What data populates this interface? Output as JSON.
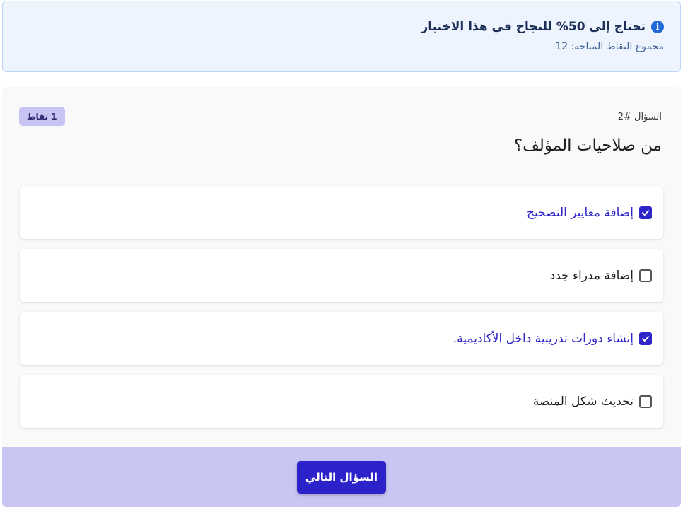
{
  "info": {
    "icon": "info-icon",
    "title": "تحتاج إلى 50% للنجاح في هذا الاختبار",
    "subtitle": "مجموع النقاط المتاحة: 12"
  },
  "question": {
    "number": "السؤال #2",
    "points": "1 نقاط",
    "text": "من صلاحيات المؤلف؟",
    "options": [
      {
        "label": "إضافة معايير التصحيح",
        "checked": true
      },
      {
        "label": "إضافة مدراء جدد",
        "checked": false
      },
      {
        "label": "إنشاء دورات تدريبية داخل الأكاديمية.",
        "checked": true
      },
      {
        "label": "تحديث شكل المنصة",
        "checked": false
      }
    ]
  },
  "footer": {
    "next_label": "السؤال التالي"
  },
  "colors": {
    "accent": "#2c22c9",
    "banner_bg": "#eef4fd",
    "footer_bg": "#c9c6f4",
    "badge_bg": "#c7c4f4"
  }
}
